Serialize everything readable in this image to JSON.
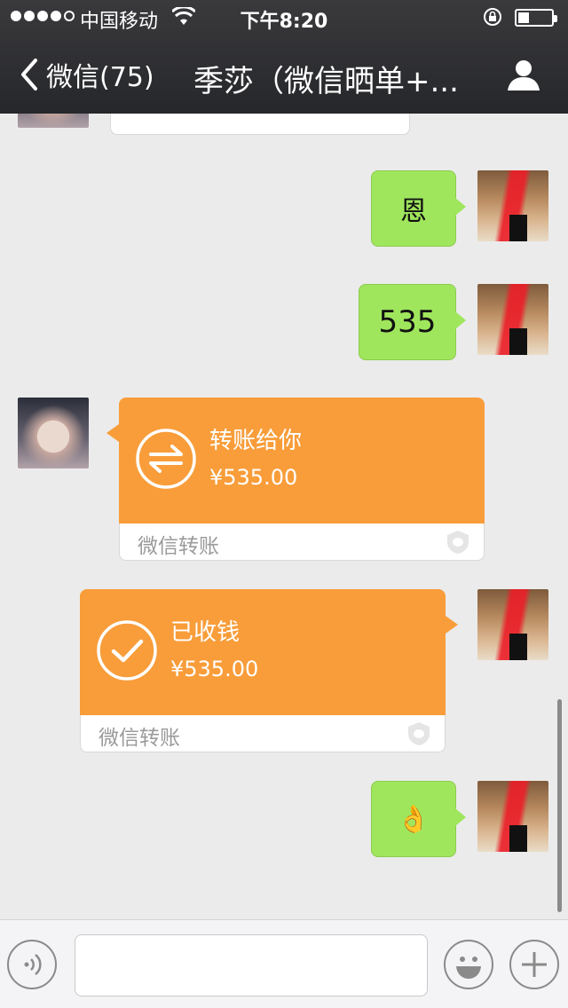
{
  "status_bar": {
    "carrier": "中国移动",
    "time": "下午8:20"
  },
  "nav": {
    "back_label": "微信(75)",
    "title": "季莎（微信晒单+..."
  },
  "messages": [
    {
      "side": "right",
      "type": "text",
      "text": "恩"
    },
    {
      "side": "right",
      "type": "text",
      "text": "535"
    },
    {
      "side": "left",
      "type": "transfer",
      "title": "转账给你",
      "amount": "¥535.00",
      "footer": "微信转账",
      "icon": "transfer-arrows-icon"
    },
    {
      "side": "right",
      "type": "transfer",
      "title": "已收钱",
      "amount": "¥535.00",
      "footer": "微信转账",
      "icon": "checkmark-icon"
    },
    {
      "side": "right",
      "type": "emoji",
      "text": "👌"
    }
  ],
  "input": {
    "placeholder": ""
  },
  "colors": {
    "chat_background": "#ebebeb",
    "green_bubble": "#9fe65d",
    "transfer_orange": "#f89d3a",
    "nav_background": "#2e2f32"
  }
}
